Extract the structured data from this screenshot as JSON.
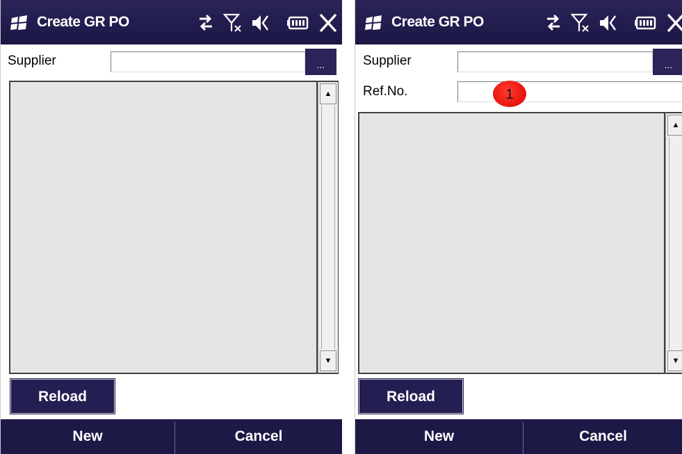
{
  "left_screen": {
    "title": "Create GR PO",
    "supplier_label": "Supplier",
    "browse_label": "...",
    "reload_label": "Reload",
    "softkeys": [
      "New",
      "Cancel"
    ]
  },
  "right_screen": {
    "title": "Create GR PO",
    "supplier_label": "Supplier",
    "ref_label": "Ref.No.",
    "browse_label": "...",
    "reload_label": "Reload",
    "softkeys": [
      "New",
      "Cancel"
    ],
    "annotation_marker": "1"
  },
  "colors": {
    "titlebar": "#2a2458",
    "softkey_bar": "#1d1947",
    "marker": "#e00000",
    "list_background": "#e5e5e5"
  },
  "icons": [
    "windows-logo-icon",
    "sync-arrows-icon",
    "no-signal-icon",
    "speaker-muted-icon",
    "battery-icon",
    "close-icon",
    "scroll-up-arrow-icon",
    "scroll-down-arrow-icon"
  ]
}
